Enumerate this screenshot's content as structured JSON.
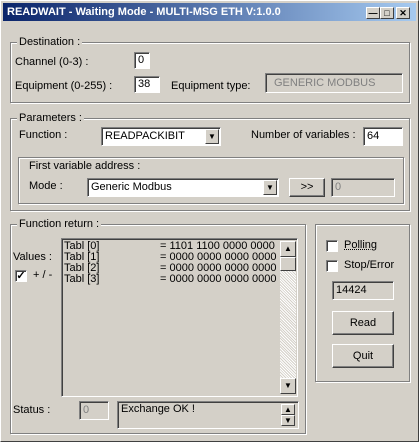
{
  "window": {
    "title": "READWAIT - Waiting Mode - MULTI-MSG ETH  V:1.0.0"
  },
  "destination": {
    "legend": "Destination :",
    "channel_label": "Channel (0-3) :",
    "channel_value": "0",
    "equipment_label": "Equipment (0-255) :",
    "equipment_value": "38",
    "equipment_type_label": "Equipment type:",
    "equipment_type_value": "GENERIC MODBUS"
  },
  "parameters": {
    "legend": "Parameters :",
    "function_label": "Function :",
    "function_value": "READPACKIBIT",
    "nvars_label": "Number of variables :",
    "nvars_value": "64",
    "first_var_legend": "First variable address :",
    "mode_label": "Mode :",
    "mode_value": "Generic Modbus",
    "next_button": ">>",
    "address_value": "0"
  },
  "function_return": {
    "legend": "Function return :",
    "values_label": "Values :",
    "plusminus_label": "+ / -",
    "plusminus_checked": true,
    "rows": [
      {
        "name": "Tabl [0]",
        "value": "= 1101 1100 0000 0000"
      },
      {
        "name": "Tabl [1]",
        "value": "= 0000 0000 0000 0000"
      },
      {
        "name": "Tabl [2]",
        "value": "= 0000 0000 0000 0000"
      },
      {
        "name": "Tabl [3]",
        "value": "= 0000 0000 0000 0000"
      }
    ],
    "status_label": "Status :",
    "status_code": "0",
    "status_message": "Exchange OK !"
  },
  "side": {
    "polling_label": "Polling",
    "polling_checked": false,
    "stop_error_label": "Stop/Error",
    "stop_error_checked": false,
    "counter": "14424",
    "read_button": "Read",
    "quit_button": "Quit"
  }
}
